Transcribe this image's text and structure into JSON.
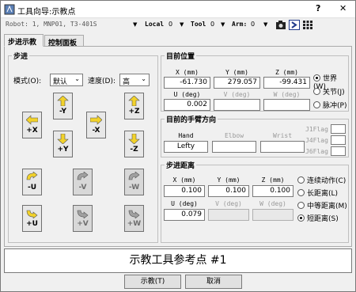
{
  "window": {
    "title": "工具向导:示教点",
    "help": "?",
    "close": "✕"
  },
  "toolbar": {
    "robot": "Robot: 1, MNP01, T3-401S",
    "local_label": "Local",
    "local_value": "0",
    "tool_label": "Tool",
    "tool_value": "0",
    "arm_label": "Arm:",
    "arm_value": "0"
  },
  "tabs": [
    "步进示教",
    "控制面板"
  ],
  "step": {
    "legend": "步进",
    "mode_label": "模式(O):",
    "mode_value": "默认",
    "speed_label": "速度(D):",
    "speed_value": "高",
    "buttons": [
      "-Y",
      "+Z",
      "+X",
      "-X",
      "+Y",
      "-Z",
      "-U",
      "-V",
      "-W",
      "+U",
      "+V",
      "+W"
    ]
  },
  "current_position": {
    "legend": "目前位置",
    "labels": [
      "X (mm)",
      "Y (mm)",
      "Z (mm)",
      "U (deg)",
      "V (deg)",
      "W (deg)"
    ],
    "values": [
      "-61.730",
      "279.057",
      "-99.431",
      "0.002",
      "",
      ""
    ],
    "radios": [
      "世界(W)",
      "关节(J)",
      "脉冲(P)"
    ],
    "radio_selected": 0
  },
  "hand": {
    "legend": "目前的手臂方向",
    "labels": [
      "Hand",
      "Elbow",
      "Wrist"
    ],
    "values": [
      "Lefty",
      "",
      ""
    ],
    "flags": [
      "J1Flag",
      "J4Flag",
      "J6Flag"
    ]
  },
  "step_distance": {
    "legend": "步进距离",
    "labels": [
      "X (mm)",
      "Y (mm)",
      "Z (mm)",
      "U (deg)",
      "V (deg)",
      "W (deg)"
    ],
    "values": [
      "0.100",
      "0.100",
      "0.100",
      "0.079",
      "",
      ""
    ],
    "radios": [
      "连续动作(C)",
      "长距离(L)",
      "中等距离(M)",
      "短距离(S)"
    ],
    "radio_selected": 3
  },
  "point_title": "示教工具参考点 #1",
  "teach_button": "示教(T)",
  "cancel_button": "取消",
  "colors": {
    "arrow_yellow": "#f2d22a",
    "arrow_dim": "#a0a0a0"
  }
}
